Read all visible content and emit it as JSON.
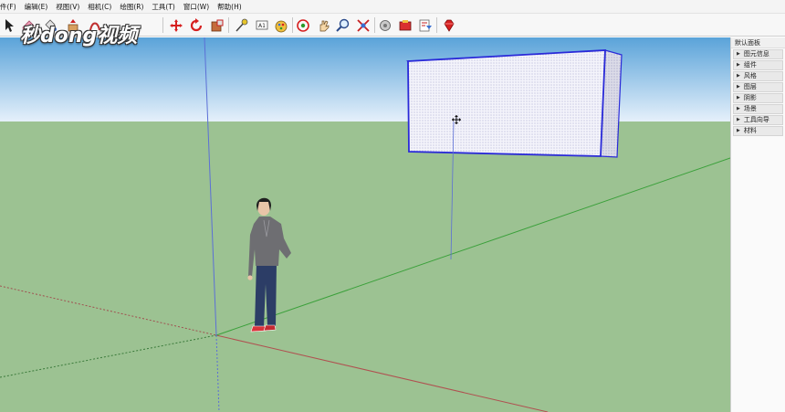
{
  "menu": {
    "items": [
      "件(F)",
      "编辑(E)",
      "视图(V)",
      "相机(C)",
      "绘图(R)",
      "工具(T)",
      "窗口(W)",
      "帮助(H)"
    ]
  },
  "toolbar": {
    "icons": [
      "select-arrow-icon",
      "eraser-icon",
      "paint-bucket-icon",
      "push-pull-icon",
      "follow-me-icon",
      "move-icon",
      "rotate-icon",
      "scale-icon",
      "tape-measure-icon",
      "text-icon",
      "paint-icon",
      "orbit-icon",
      "pan-icon",
      "zoom-icon",
      "zoom-extents-icon",
      "previous-view-icon",
      "next-view-icon",
      "warehouse-icon",
      "ruby-icon"
    ]
  },
  "logo": {
    "text": "秒dong视频"
  },
  "tray": {
    "title": "默认面板",
    "items": [
      "图元信息",
      "组件",
      "风格",
      "图层",
      "阴影",
      "场景",
      "工具向导",
      "材料"
    ]
  },
  "colors": {
    "sky_top": "#5aa3d9",
    "sky_bottom": "#e7f1fb",
    "ground": "#9cc292",
    "red_axis": "#b05050",
    "green_axis": "#3aa03a",
    "blue_axis": "#5b6fd6",
    "selection": "#2a2ad8"
  }
}
